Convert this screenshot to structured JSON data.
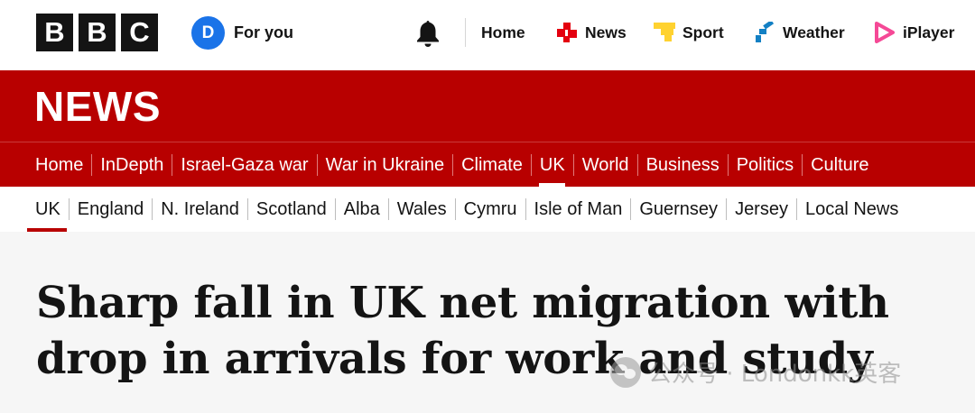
{
  "brand": {
    "logo_letters": [
      "B",
      "B",
      "C"
    ]
  },
  "account": {
    "avatar_initial": "D",
    "for_you_label": "For you"
  },
  "top_nav": [
    {
      "label": "Home",
      "icon": "none"
    },
    {
      "label": "News",
      "icon": "news-icon",
      "color": "#e4000f"
    },
    {
      "label": "Sport",
      "icon": "sport-icon",
      "color": "#ffd230"
    },
    {
      "label": "Weather",
      "icon": "weather-icon",
      "color": "#1380c4"
    },
    {
      "label": "iPlayer",
      "icon": "iplayer-icon",
      "color": "#f54996"
    }
  ],
  "news_banner": {
    "title": "NEWS"
  },
  "section_nav": [
    {
      "label": "Home"
    },
    {
      "label": "InDepth"
    },
    {
      "label": "Israel-Gaza war"
    },
    {
      "label": "War in Ukraine"
    },
    {
      "label": "Climate"
    },
    {
      "label": "UK",
      "active": true
    },
    {
      "label": "World"
    },
    {
      "label": "Business"
    },
    {
      "label": "Politics"
    },
    {
      "label": "Culture"
    }
  ],
  "sub_nav": [
    {
      "label": "UK",
      "active": true
    },
    {
      "label": "England"
    },
    {
      "label": "N. Ireland"
    },
    {
      "label": "Scotland"
    },
    {
      "label": "Alba"
    },
    {
      "label": "Wales"
    },
    {
      "label": "Cymru"
    },
    {
      "label": "Isle of Man"
    },
    {
      "label": "Guernsey"
    },
    {
      "label": "Jersey"
    },
    {
      "label": "Local News"
    }
  ],
  "article": {
    "headline": "Sharp fall in UK net migration with drop in arrivals for work and study"
  },
  "watermark": {
    "text": "公众号 · Londonkk英客"
  },
  "colors": {
    "bbc_red": "#b80000",
    "avatar_blue": "#1a73e8"
  }
}
